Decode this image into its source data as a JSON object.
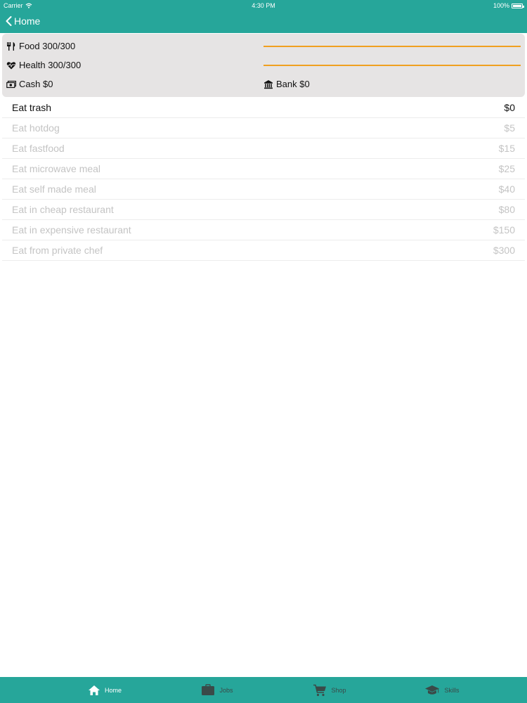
{
  "status_bar": {
    "carrier": "Carrier",
    "time": "4:30 PM",
    "battery": "100%"
  },
  "nav": {
    "back_label": "Home"
  },
  "stats": {
    "food": {
      "label": "Food 300/300",
      "level": 1.0
    },
    "health": {
      "label": "Health 300/300",
      "level": 1.0
    },
    "cash": {
      "label": "Cash $0"
    },
    "bank": {
      "label": "Bank $0"
    }
  },
  "items": [
    {
      "label": "Eat trash",
      "price": "$0",
      "enabled": true
    },
    {
      "label": "Eat hotdog",
      "price": "$5",
      "enabled": false
    },
    {
      "label": "Eat fastfood",
      "price": "$15",
      "enabled": false
    },
    {
      "label": "Eat microwave meal",
      "price": "$25",
      "enabled": false
    },
    {
      "label": "Eat self made meal",
      "price": "$40",
      "enabled": false
    },
    {
      "label": "Eat in cheap restaurant",
      "price": "$80",
      "enabled": false
    },
    {
      "label": "Eat in expensive restaurant",
      "price": "$150",
      "enabled": false
    },
    {
      "label": "Eat from private chef",
      "price": "$300",
      "enabled": false
    }
  ],
  "tabs": [
    {
      "label": "Home",
      "icon": "home-icon",
      "active": true
    },
    {
      "label": "Jobs",
      "icon": "briefcase-icon",
      "active": false
    },
    {
      "label": "Shop",
      "icon": "cart-icon",
      "active": false
    },
    {
      "label": "Skills",
      "icon": "graduation-cap-icon",
      "active": false
    }
  ],
  "colors": {
    "accent": "#26a69a",
    "bar": "#f0a020",
    "panel": "#e6e4e4",
    "disabled_text": "#c4c4c4"
  }
}
